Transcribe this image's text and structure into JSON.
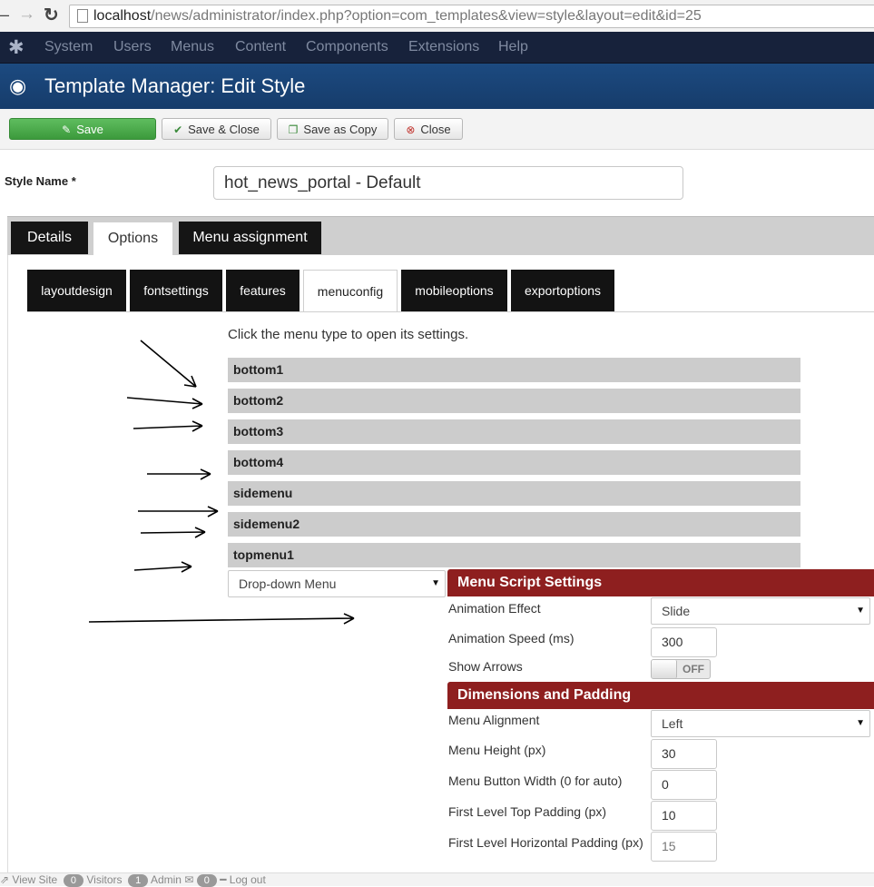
{
  "browser": {
    "url_host": "localhost",
    "url_path": "/news/administrator/index.php?option=com_templates&view=style&layout=edit&id=25"
  },
  "navbar": {
    "items": [
      "System",
      "Users",
      "Menus",
      "Content",
      "Components",
      "Extensions",
      "Help"
    ]
  },
  "header": {
    "title": "Template Manager: Edit Style"
  },
  "toolbar": {
    "save": "Save",
    "save_close": "Save & Close",
    "save_copy": "Save as Copy",
    "close": "Close"
  },
  "form": {
    "style_name_label": "Style Name *",
    "style_name_value": "hot_news_portal - Default"
  },
  "tabs": {
    "main": [
      "Details",
      "Options",
      "Menu assignment"
    ],
    "active_main": "Options",
    "sub": [
      "layoutdesign",
      "fontsettings",
      "features",
      "menuconfig",
      "mobileoptions",
      "exportoptions"
    ],
    "active_sub": "menuconfig"
  },
  "menuconfig": {
    "instruction": "Click the menu type to open its settings.",
    "menus": [
      "bottom1",
      "bottom2",
      "bottom3",
      "bottom4",
      "sidemenu",
      "sidemenu2",
      "topmenu1"
    ],
    "menu_type_select": "Drop-down Menu"
  },
  "script_settings": {
    "header": "Menu Script Settings",
    "animation_effect_label": "Animation Effect",
    "animation_effect_value": "Slide",
    "animation_speed_label": "Animation Speed (ms)",
    "animation_speed_value": "300",
    "show_arrows_label": "Show Arrows",
    "show_arrows_value": "OFF"
  },
  "dimensions": {
    "header": "Dimensions and Padding",
    "alignment_label": "Menu Alignment",
    "alignment_value": "Left",
    "height_label": "Menu Height (px)",
    "height_value": "30",
    "button_width_label": "Menu Button Width (0 for auto)",
    "button_width_value": "0",
    "top_padding_label": "First Level Top Padding (px)",
    "top_padding_value": "10",
    "horizontal_padding_label": "First Level Horizontal Padding (px)",
    "horizontal_padding_value": "15"
  },
  "status_bar": {
    "view_site": "View Site",
    "visitors_count": "0",
    "visitors": "Visitors",
    "admin_count": "1",
    "admin": "Admin",
    "messages_count": "0",
    "logout": "Log out"
  },
  "colors": {
    "navbar": "#17223b",
    "header": "#1c4a80",
    "save_button": "#4cae4c",
    "section_header": "#8e1f1f",
    "menu_row": "#cccccc"
  }
}
